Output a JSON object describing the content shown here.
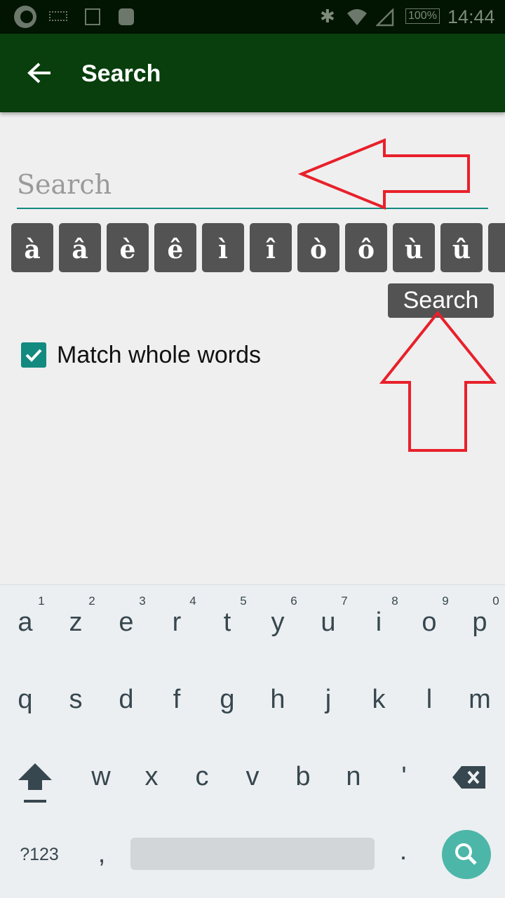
{
  "status_bar": {
    "time": "14:44",
    "battery": "100%",
    "icons": [
      "app-logo-icon",
      "keyboard-icon",
      "image-icon",
      "android-icon",
      "bluetooth-icon",
      "wifi-icon",
      "signal-icon",
      "battery-icon"
    ]
  },
  "app_bar": {
    "title": "Search",
    "back_icon": "arrow-back-icon"
  },
  "search": {
    "placeholder": "Search",
    "value": ""
  },
  "accent_keys": [
    "à",
    "â",
    "è",
    "ê",
    "ì",
    "î",
    "ò",
    "ô",
    "ù",
    "û"
  ],
  "search_button": "Search",
  "match_whole_words": {
    "label": "Match whole words",
    "checked": true
  },
  "keyboard": {
    "row1": [
      [
        "a",
        "1"
      ],
      [
        "z",
        "2"
      ],
      [
        "e",
        "3"
      ],
      [
        "r",
        "4"
      ],
      [
        "t",
        "5"
      ],
      [
        "y",
        "6"
      ],
      [
        "u",
        "7"
      ],
      [
        "i",
        "8"
      ],
      [
        "o",
        "9"
      ],
      [
        "p",
        "0"
      ]
    ],
    "row2": [
      "q",
      "s",
      "d",
      "f",
      "g",
      "h",
      "j",
      "k",
      "l",
      "m"
    ],
    "row3": [
      "w",
      "x",
      "c",
      "v",
      "b",
      "n",
      "'"
    ],
    "symbols": "?123",
    "comma": ",",
    "period": "."
  },
  "colors": {
    "app_bar": "#083f0c",
    "accent": "#138a80",
    "annotation": "#e8202a"
  }
}
